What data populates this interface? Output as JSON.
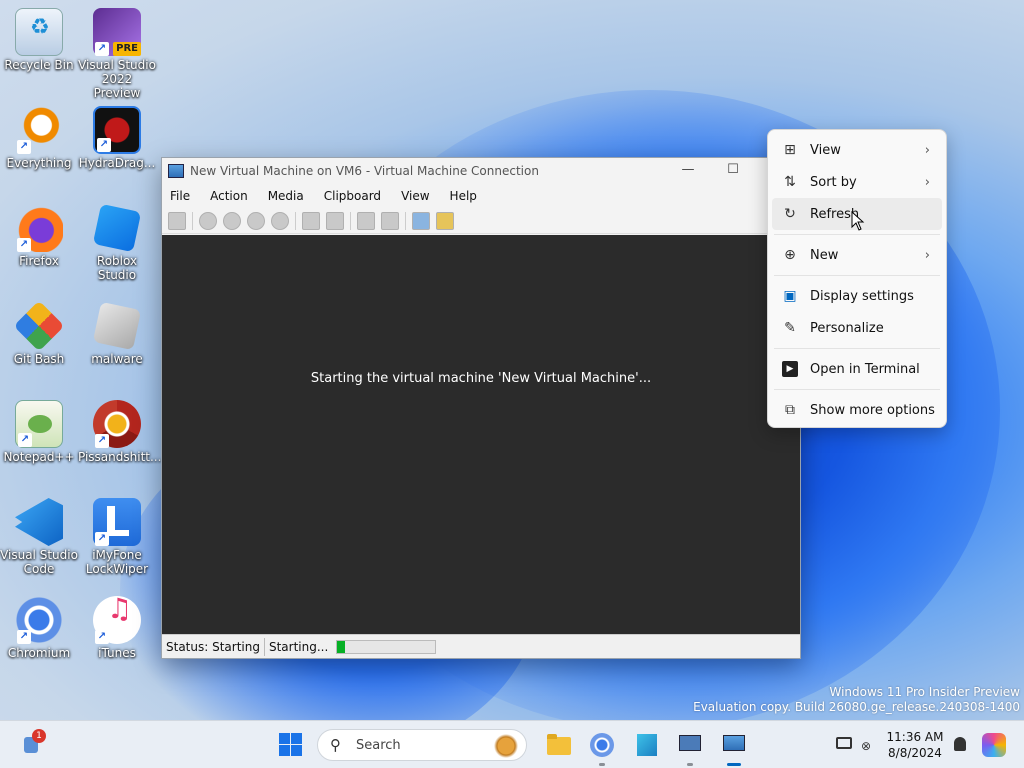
{
  "desktop": {
    "icons": [
      {
        "label": "Recycle Bin"
      },
      {
        "label": "Visual Studio 2022 Preview",
        "badge": "PRE"
      },
      {
        "label": "Everything"
      },
      {
        "label": "HydraDrag..."
      },
      {
        "label": "Firefox"
      },
      {
        "label": "Roblox Studio"
      },
      {
        "label": "Git Bash"
      },
      {
        "label": "malware"
      },
      {
        "label": "Notepad++"
      },
      {
        "label": "Pissandshitt..."
      },
      {
        "label": "Visual Studio Code"
      },
      {
        "label": "iMyFone LockWiper"
      },
      {
        "label": "Chromium"
      },
      {
        "label": "iTunes"
      }
    ],
    "shortcut_glyph": "↗"
  },
  "vm_window": {
    "title": "New Virtual Machine on VM6 - Virtual Machine Connection",
    "minimize_glyph": "—",
    "maximize_glyph": "☐",
    "menu": [
      "File",
      "Action",
      "Media",
      "Clipboard",
      "View",
      "Help"
    ],
    "screen_message": "Starting the virtual machine 'New Virtual Machine'...",
    "status_label": "Status: Starting",
    "status_detail": "Starting...",
    "progress_fraction": 0.08
  },
  "context_menu": {
    "items": [
      {
        "label": "View",
        "icon": "grid-icon",
        "glyph": "⊞",
        "submenu": true
      },
      {
        "label": "Sort by",
        "icon": "sort-icon",
        "glyph": "⇅",
        "submenu": true
      },
      {
        "label": "Refresh",
        "icon": "refresh-icon",
        "glyph": "↻",
        "submenu": false,
        "hover": true
      },
      {
        "label": "New",
        "icon": "plus-circle-icon",
        "glyph": "⊕",
        "submenu": true
      },
      {
        "label": "Display settings",
        "icon": "display-settings-icon",
        "glyph": "▣",
        "submenu": false
      },
      {
        "label": "Personalize",
        "icon": "brush-icon",
        "glyph": "✎",
        "submenu": false
      },
      {
        "label": "Open in Terminal",
        "icon": "terminal-icon",
        "glyph": "▶",
        "submenu": false
      },
      {
        "label": "Show more options",
        "icon": "more-options-icon",
        "glyph": "⧉",
        "submenu": false
      }
    ],
    "chevron_glyph": "›"
  },
  "watermark": {
    "line1": "Windows 11 Pro Insider Preview",
    "line2": "Evaluation copy. Build 26080.ge_release.240308-1400"
  },
  "taskbar": {
    "search_placeholder": "Search",
    "search_glyph": "⚲",
    "notification_count": "1",
    "time": "11:36 AM",
    "date": "8/8/2024"
  },
  "colors": {
    "accent": "#0067c0",
    "progress": "#06b025",
    "vm_screen": "#2b2b2b"
  }
}
